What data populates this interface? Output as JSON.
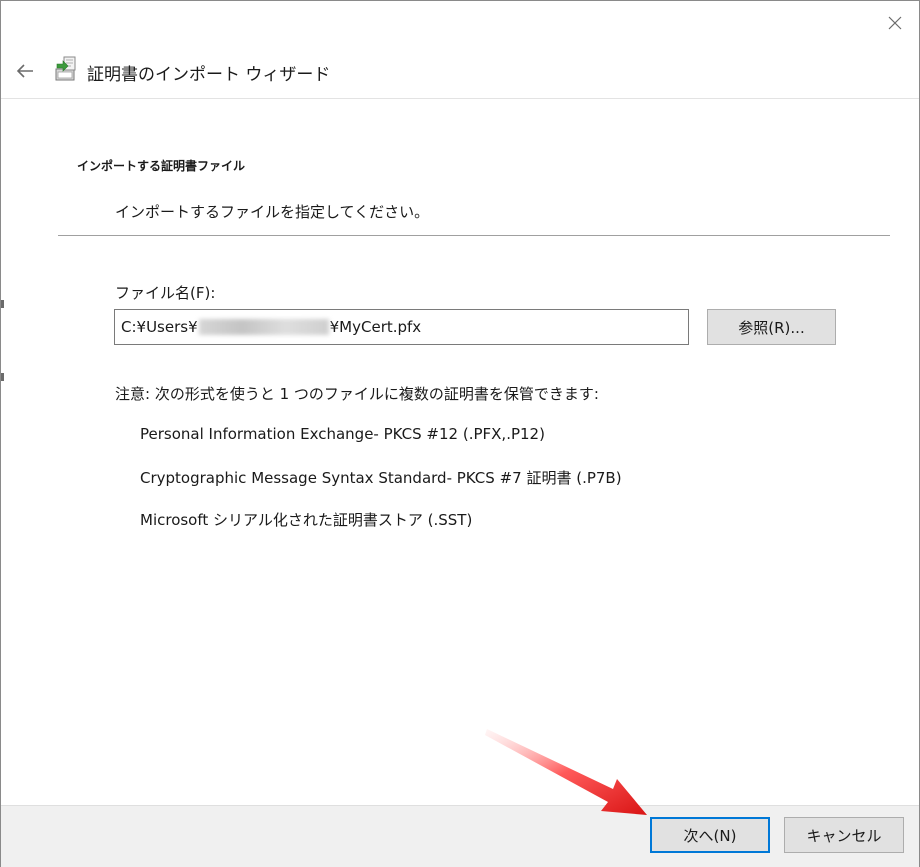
{
  "window": {
    "title": "証明書のインポート ウィザード"
  },
  "page": {
    "heading": "インポートする証明書ファイル",
    "description": "インポートするファイルを指定してください。"
  },
  "file": {
    "label": "ファイル名(F):",
    "value_prefix": "C:¥Users¥",
    "value_suffix": "¥MyCert.pfx",
    "browse_label": "参照(R)..."
  },
  "note": {
    "text": "注意: 次の形式を使うと 1 つのファイルに複数の証明書を保管できます:",
    "formats": [
      "Personal Information Exchange- PKCS #12 (.PFX,.P12)",
      "Cryptographic Message Syntax Standard- PKCS #7 証明書 (.P7B)",
      "Microsoft シリアル化された証明書ストア (.SST)"
    ]
  },
  "footer": {
    "next_label": "次へ(N)",
    "cancel_label": "キャンセル"
  },
  "colors": {
    "accent": "#0078d7",
    "arrow": "#e32222"
  }
}
